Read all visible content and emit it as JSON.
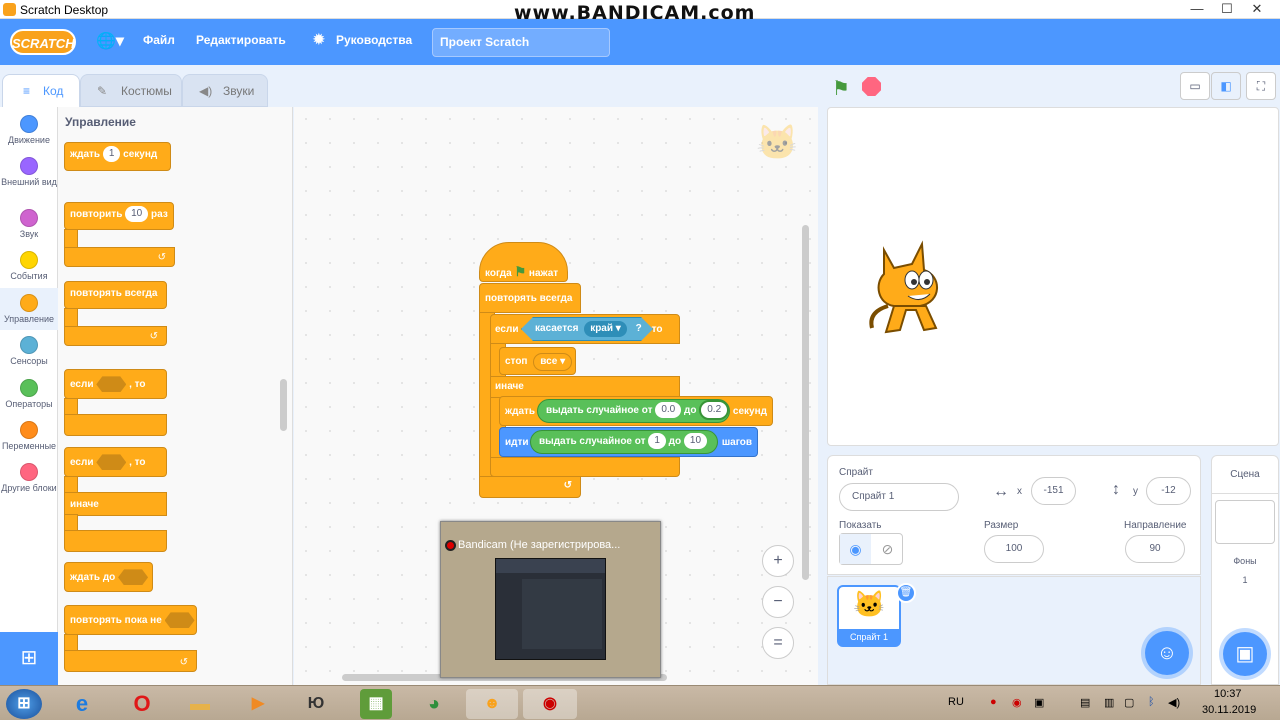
{
  "window": {
    "title": "Scratch Desktop",
    "watermark": "www.BANDICAM.com",
    "minimize": "—",
    "maximize": "☐",
    "close": "✕"
  },
  "menubar": {
    "logo": "SCRATCH",
    "globe_icon": "globe-icon",
    "file": "Файл",
    "edit": "Редактировать",
    "tutorials": "Руководства",
    "project_title": "Проект Scratch"
  },
  "tabs": {
    "code": "Код",
    "costumes": "Костюмы",
    "sounds": "Звуки"
  },
  "categories": [
    {
      "label": "Движение",
      "color": "#4c97ff"
    },
    {
      "label": "Внешний вид",
      "color": "#9966ff"
    },
    {
      "label": "Звук",
      "color": "#cf63cf"
    },
    {
      "label": "События",
      "color": "#ffd500"
    },
    {
      "label": "Управление",
      "color": "#ffab19"
    },
    {
      "label": "Сенсоры",
      "color": "#5cb1d6"
    },
    {
      "label": "Операторы",
      "color": "#59c059"
    },
    {
      "label": "Переменные",
      "color": "#ff8c1a"
    },
    {
      "label": "Другие блоки",
      "color": "#ff6680"
    }
  ],
  "palette": {
    "header": "Управление",
    "wait": {
      "label1": "ждать",
      "value": "1",
      "label2": "секунд"
    },
    "repeat": {
      "label1": "повторить",
      "value": "10",
      "label2": "раз"
    },
    "forever": "повторять всегда",
    "if_then": {
      "label1": "если",
      "label2": ", то"
    },
    "if_else": {
      "label1": "если",
      "label2": ", то",
      "else": "иначе"
    },
    "wait_until": "ждать до",
    "repeat_until": "повторять пока не",
    "loop_glyph": "↺"
  },
  "script": {
    "hat": {
      "label1": "когда",
      "label2": "нажат"
    },
    "forever": "повторять всегда",
    "if": {
      "label1": "если",
      "label2": ", то"
    },
    "touching": {
      "label": "касается",
      "option": "край",
      "suffix": "?"
    },
    "stop": {
      "label": "стоп",
      "option": "все"
    },
    "else": "иначе",
    "wait": {
      "label": "ждать",
      "suffix": "секунд"
    },
    "random1": {
      "label": "выдать случайное от",
      "from": "0.0",
      "to_label": "до",
      "to": "0.2"
    },
    "move": {
      "label": "идти",
      "suffix": "шагов"
    },
    "random2": {
      "label": "выдать случайное от",
      "from": "1",
      "to_label": "до",
      "to": "10"
    },
    "loop_glyph": "↺"
  },
  "workspace": {
    "zoom_in": "+",
    "zoom_out": "−",
    "reset": "="
  },
  "stage_controls": {
    "small": "▭",
    "normal": "◧",
    "fullscreen": "⛶"
  },
  "sprite": {
    "label": "Спрайт",
    "name": "Спрайт 1",
    "x_label": "x",
    "x": "-151",
    "y_label": "y",
    "y": "-12",
    "show_label": "Показать",
    "size_label": "Размер",
    "size": "100",
    "direction_label": "Направление",
    "direction": "90",
    "card_name": "Спрайт 1"
  },
  "stage_panel": {
    "title": "Сцена",
    "backdrops_label": "Фоны",
    "backdrops_count": "1"
  },
  "bandicam": {
    "title": "Bandicam (Не зарегистрирова..."
  },
  "taskbar": {
    "lang": "RU",
    "time": "10:37",
    "date": "30.11.2019",
    "yu": "Ю"
  }
}
